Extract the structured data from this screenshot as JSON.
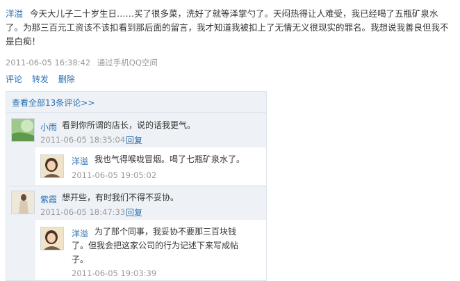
{
  "post": {
    "author": "洋溢",
    "text": "今天大儿子二十岁生日……买了很多菜，洗好了就等泽掌勺了。天闷热得让人难受，我已经喝了五瓶矿泉水了。为那三百元工资该不该扣看到那后面的留言，我才知道我被扣上了无情无义很现实的罪名。我想说我善良但我不是白痴！",
    "timestamp": "2011-06-05 16:38:42",
    "source": "通过手机QQ空间"
  },
  "actions": {
    "comment": "评论",
    "forward": "转发",
    "delete": "删除"
  },
  "comments": {
    "see_all": "查看全部13条评论>>",
    "items": [
      {
        "author": "小雨",
        "text": "看到你所谓的店长，说的话我更气。",
        "timestamp": "2011-06-05 18:35:04",
        "reply_label": "回复",
        "replies": [
          {
            "author": "洋溢",
            "text": "我也气得喉咙冒烟。喝了七瓶矿泉水了。",
            "timestamp": "2011-06-05 19:05:02"
          }
        ]
      },
      {
        "author": "紫霞",
        "text": "想开些，有时我们不得不妥协。",
        "timestamp": "2011-06-05 18:47:33",
        "reply_label": "回复",
        "replies": [
          {
            "author": "洋溢",
            "text_line1": "为了那个同事，我妥协不要那三百块钱",
            "text_line2": "了。但我会把这家公司的行为记述下来写成帖",
            "text_line3": "子。",
            "timestamp": "2011-06-05 19:03:39"
          }
        ]
      }
    ]
  },
  "colors": {
    "link": "#2a6fb0",
    "meta": "#999999",
    "panel": "#eef2f6"
  }
}
